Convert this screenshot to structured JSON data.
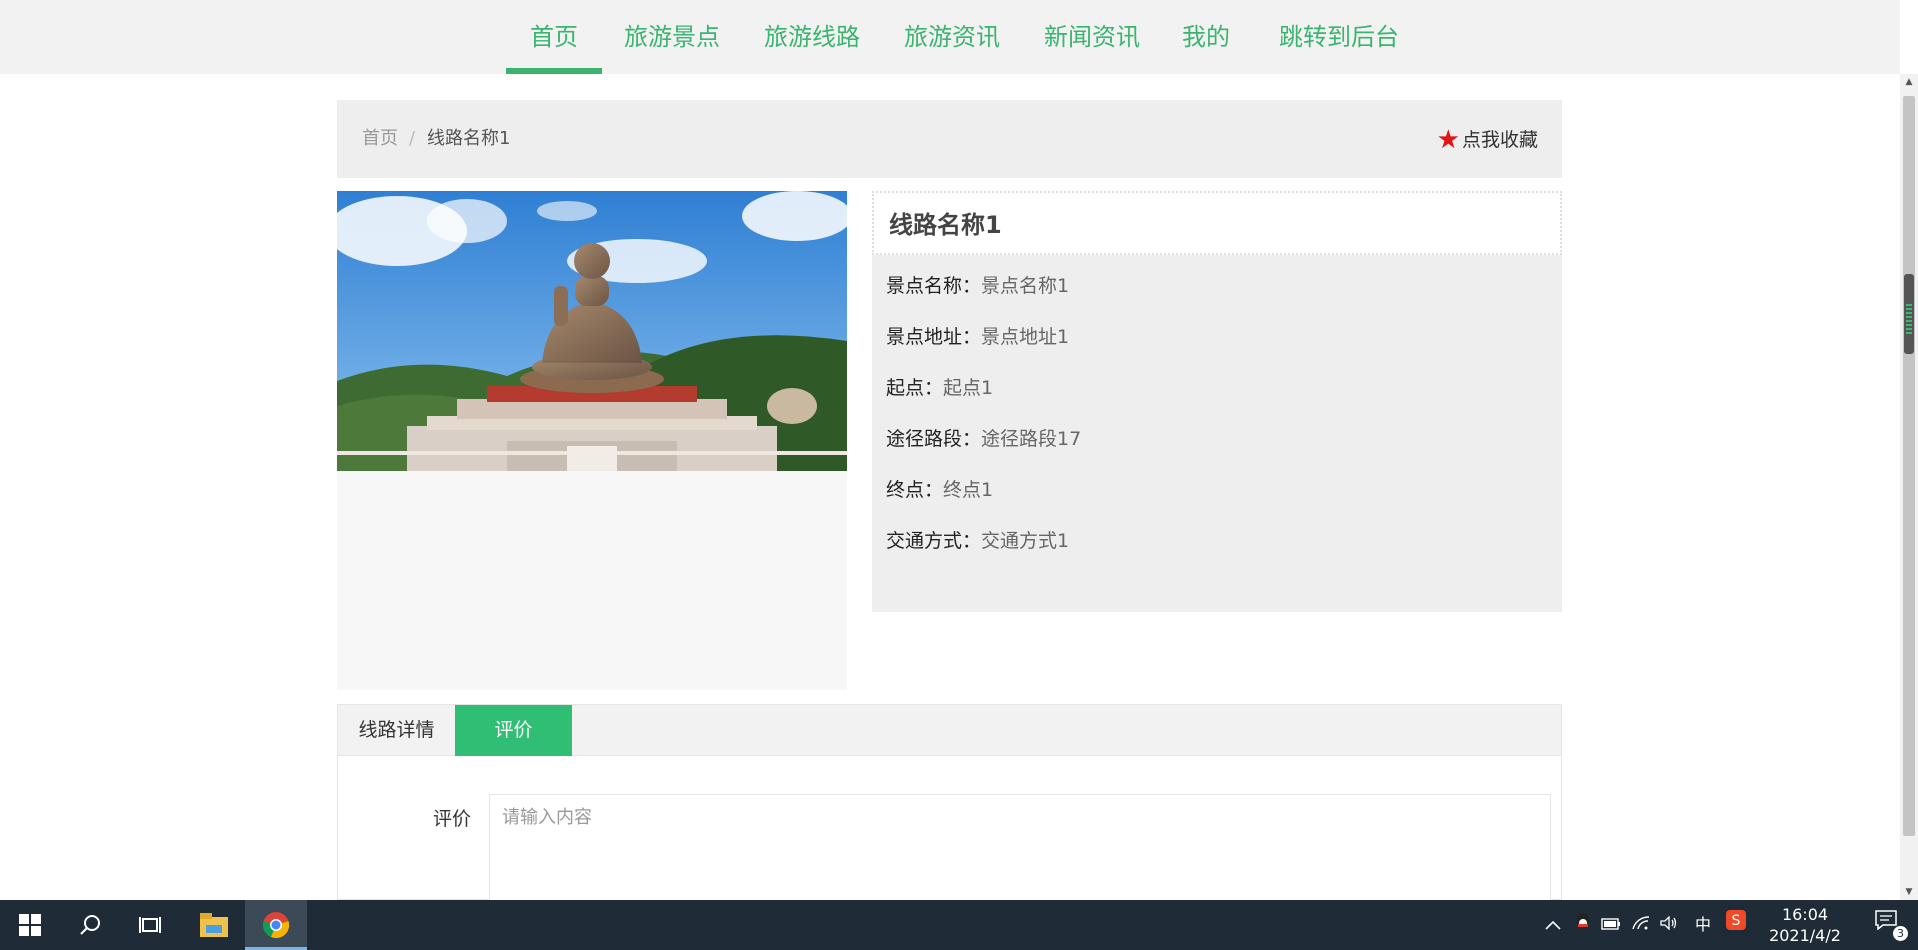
{
  "nav": {
    "items": [
      {
        "label": "首页"
      },
      {
        "label": "旅游景点"
      },
      {
        "label": "旅游线路"
      },
      {
        "label": "旅游资讯"
      },
      {
        "label": "新闻资讯"
      },
      {
        "label": "我的"
      },
      {
        "label": "跳转到后台"
      }
    ],
    "active_index": 0
  },
  "breadcrumb": {
    "home": "首页",
    "separator": "/",
    "current": "线路名称1"
  },
  "favorite": {
    "icon": "star-icon",
    "label": "点我收藏"
  },
  "route": {
    "title": "线路名称1",
    "fields": [
      {
        "label": "景点名称：",
        "value": "景点名称1"
      },
      {
        "label": "景点地址：",
        "value": "景点地址1"
      },
      {
        "label": "起点：",
        "value": "起点1"
      },
      {
        "label": "途径路段：",
        "value": "途径路段17"
      },
      {
        "label": "终点：",
        "value": "终点1"
      },
      {
        "label": "交通方式：",
        "value": "交通方式1"
      }
    ]
  },
  "tabs": {
    "detail": "线路详情",
    "review": "评价",
    "active": "review"
  },
  "review_form": {
    "label": "评价",
    "placeholder": "请输入内容",
    "value": ""
  },
  "taskbar": {
    "time": "16:04",
    "date": "2021/4/2",
    "ime": "中",
    "notification_count": "3"
  },
  "colors": {
    "accent": "#3ab46f",
    "tab_active": "#2fbe74",
    "favorite_star": "#e01515"
  }
}
